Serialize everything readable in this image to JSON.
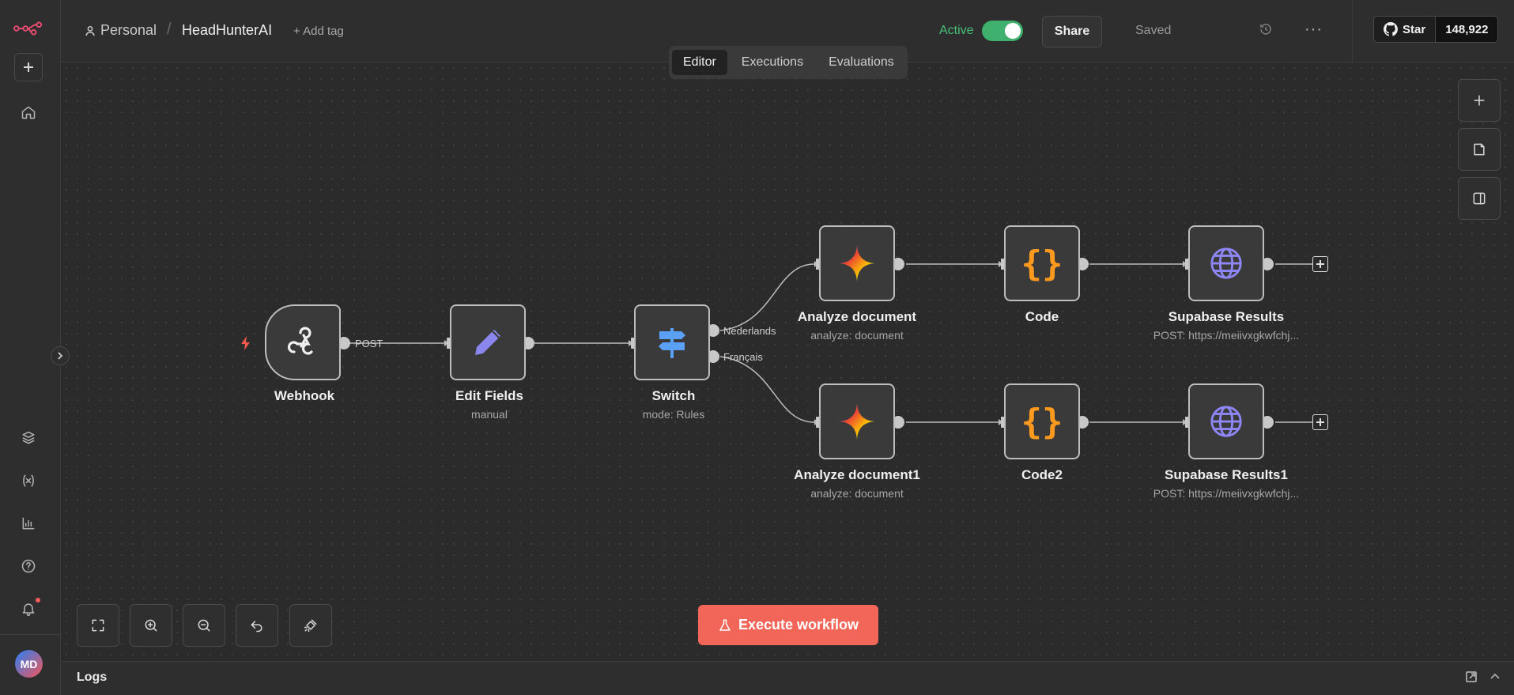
{
  "header": {
    "project": "Personal",
    "workflow_name": "HeadHunterAI",
    "add_tag": "+ Add tag",
    "active_label": "Active",
    "active": true,
    "share": "Share",
    "saved": "Saved",
    "github_star": "Star",
    "github_count": "148,922"
  },
  "tabs": [
    "Editor",
    "Executions",
    "Evaluations"
  ],
  "active_tab": "Editor",
  "nodes": {
    "webhook": {
      "title": "Webhook",
      "sub": ""
    },
    "edit_fields": {
      "title": "Edit Fields",
      "sub": "manual"
    },
    "switch": {
      "title": "Switch",
      "sub": "mode: Rules"
    },
    "analyze1": {
      "title": "Analyze document",
      "sub": "analyze: document"
    },
    "code1": {
      "title": "Code",
      "sub": ""
    },
    "supabase1": {
      "title": "Supabase Results",
      "sub": "POST: https://meiivxgkwfchj..."
    },
    "analyze2": {
      "title": "Analyze document1",
      "sub": "analyze: document"
    },
    "code2": {
      "title": "Code2",
      "sub": ""
    },
    "supabase2": {
      "title": "Supabase Results1",
      "sub": "POST: https://meiivxgkwfchj..."
    }
  },
  "edge_labels": {
    "post": "POST",
    "nl": "Nederlands",
    "fr": "Français"
  },
  "execute_button": "Execute workflow",
  "logs": {
    "title": "Logs"
  },
  "user": {
    "initials": "MD"
  },
  "colors": {
    "accent": "#f2665a",
    "active_green": "#3fb06d",
    "code_orange": "#ff9a1f",
    "globe_purple": "#8f86f5"
  },
  "icons": {
    "sidebar": [
      "n8n-logo-icon",
      "plus-icon",
      "home-icon",
      "templates-icon",
      "variables-icon",
      "insights-icon",
      "help-icon",
      "bell-icon"
    ],
    "canvas_tools": [
      "fit-view-icon",
      "zoom-in-icon",
      "zoom-out-icon",
      "undo-icon",
      "tidy-up-icon"
    ]
  }
}
